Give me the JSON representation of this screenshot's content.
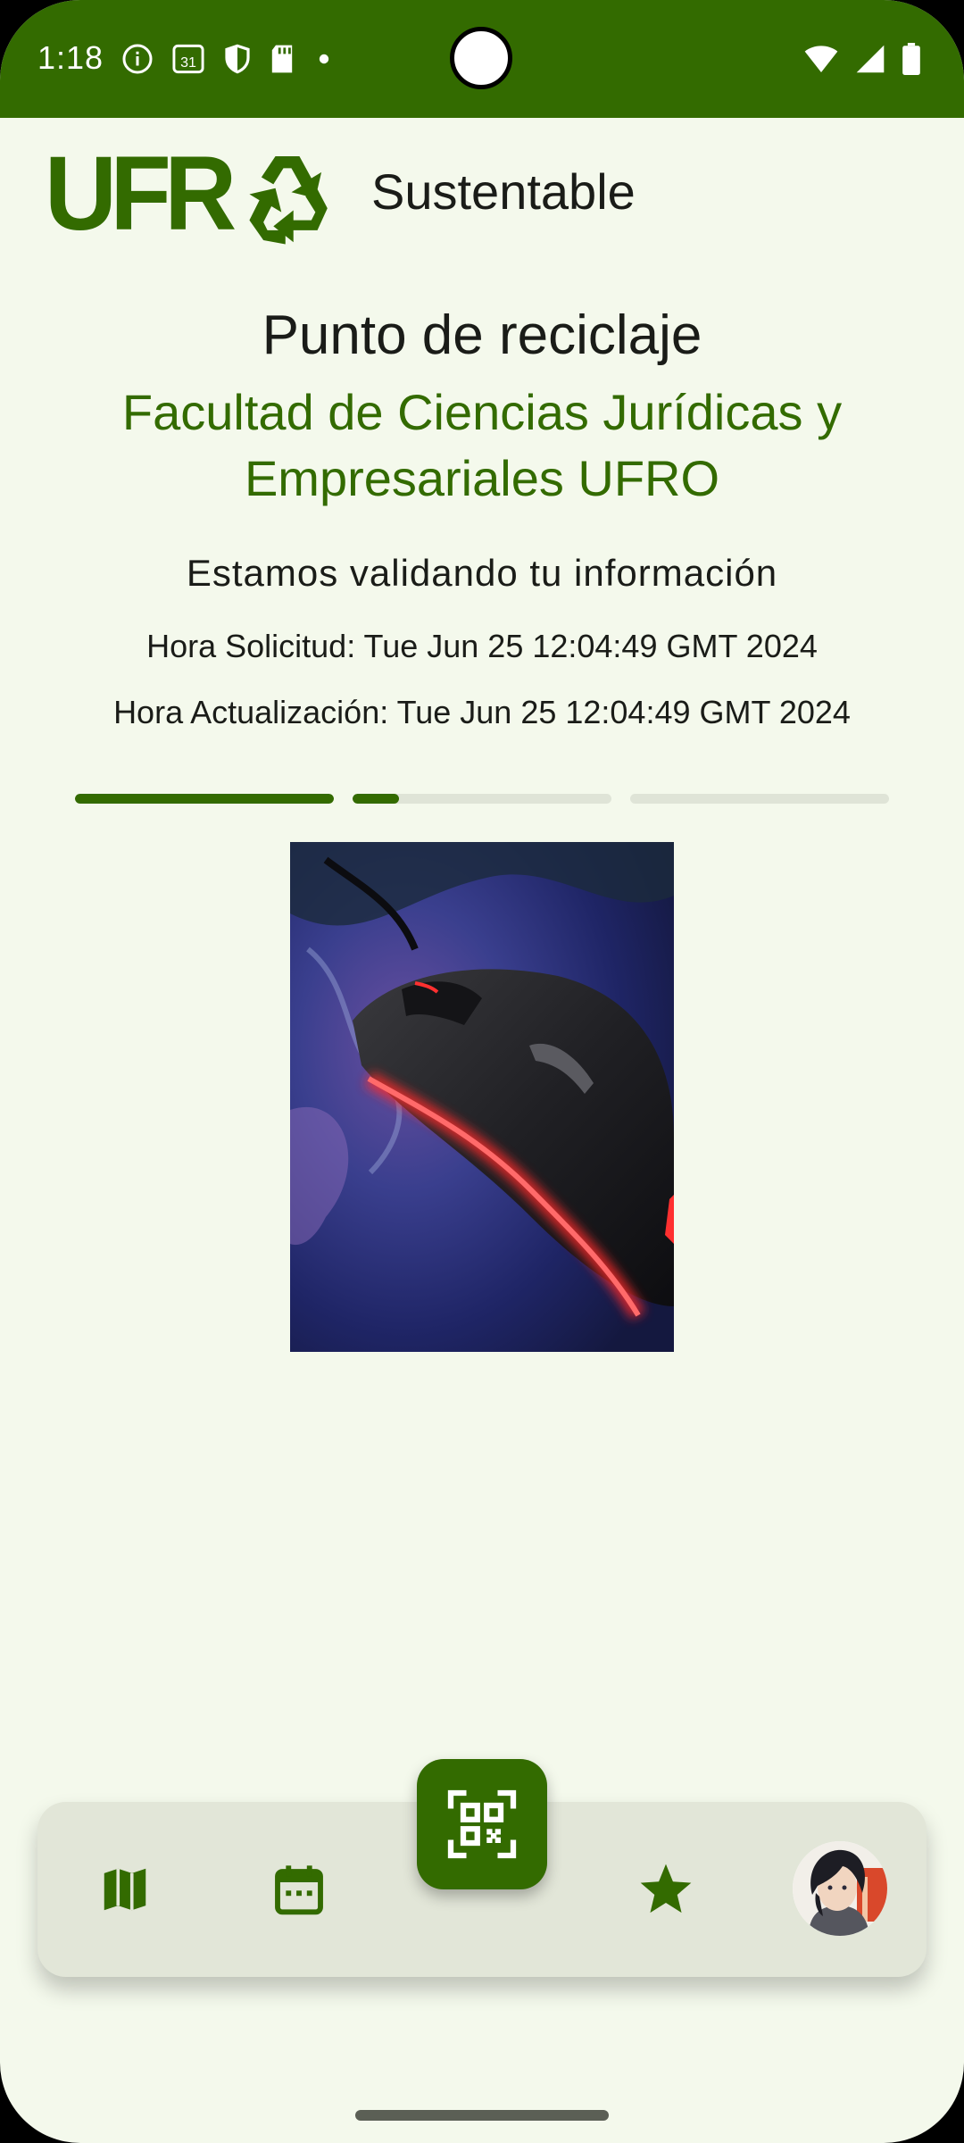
{
  "status_bar": {
    "time": "1:18",
    "calendar_day": "31"
  },
  "header": {
    "logo_text": "UFR",
    "subtitle": "Sustentable"
  },
  "content": {
    "title": "Punto de reciclaje",
    "facility": "Facultad de Ciencias Jurídicas y Empresariales UFRO",
    "status_message": "Estamos validando tu información",
    "request_time": "Hora Solicitud: Tue Jun 25 12:04:49 GMT 2024",
    "update_time": "Hora Actualización: Tue Jun 25 12:04:49 GMT 2024"
  },
  "progress": {
    "segments": [
      1.0,
      0.18,
      0.0
    ]
  },
  "nav": {
    "items": [
      "map-icon",
      "calendar-icon",
      "qr-scan-icon",
      "star-icon",
      "avatar"
    ]
  },
  "colors": {
    "primary": "#336b00",
    "background": "#f4f9ec",
    "nav_background": "#e2e6d8",
    "track": "#dfe4d7"
  }
}
